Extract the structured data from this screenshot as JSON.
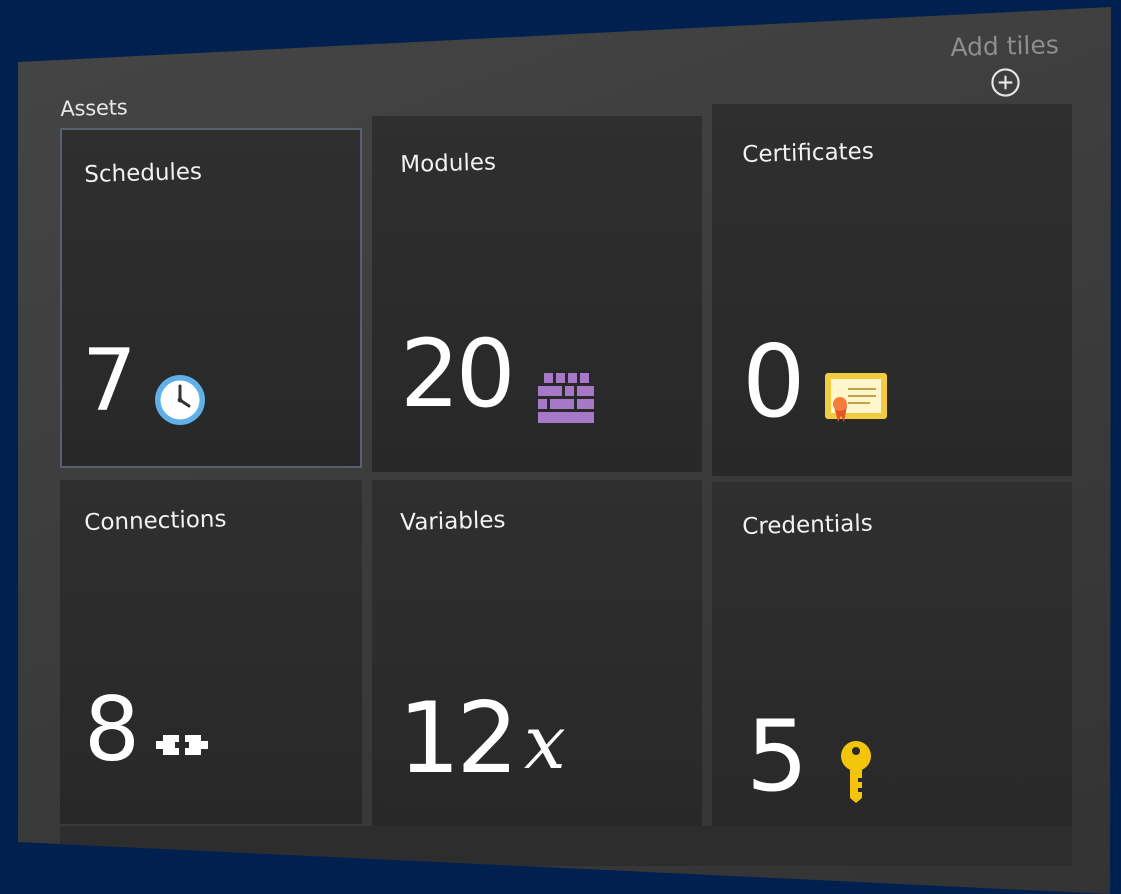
{
  "header": {
    "add_tiles_label": "Add tiles",
    "add_icon": "plus-circle-icon"
  },
  "section": {
    "title": "Assets"
  },
  "tiles": [
    {
      "title": "Schedules",
      "count": "7",
      "icon": "clock-icon",
      "selected": true
    },
    {
      "title": "Modules",
      "count": "20",
      "icon": "modules-grid-icon",
      "selected": false
    },
    {
      "title": "Certificates",
      "count": "0",
      "icon": "certificate-icon",
      "selected": false
    },
    {
      "title": "Connections",
      "count": "8",
      "icon": "connection-plug-icon",
      "selected": false
    },
    {
      "title": "Variables",
      "count": "12",
      "icon": "variable-x-icon",
      "selected": false
    },
    {
      "title": "Credentials",
      "count": "5",
      "icon": "key-icon",
      "selected": false
    }
  ],
  "colors": {
    "background": "#002050",
    "panel": "#3c3c3c",
    "tile": "#2d2d2d",
    "modules_accent": "#a878c8",
    "certificate_accent": "#f2cc40",
    "key_accent": "#f2c40c",
    "clock_accent": "#5fb0e8"
  }
}
